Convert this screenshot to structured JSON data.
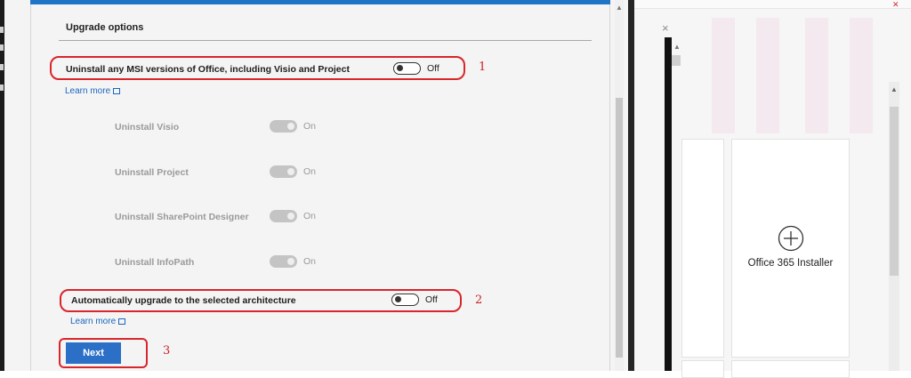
{
  "dialog": {
    "section_title": "Upgrade options",
    "uninstall_msi": {
      "label": "Uninstall any MSI versions of Office, including Visio and Project",
      "state": "Off",
      "learn_more": "Learn more"
    },
    "sub_options": [
      {
        "label": "Uninstall Visio",
        "state": "On"
      },
      {
        "label": "Uninstall Project",
        "state": "On"
      },
      {
        "label": "Uninstall SharePoint Designer",
        "state": "On"
      },
      {
        "label": "Uninstall InfoPath",
        "state": "On"
      }
    ],
    "auto_upgrade": {
      "label": "Automatically upgrade to the selected architecture",
      "state": "Off",
      "learn_more": "Learn more"
    },
    "next_label": "Next"
  },
  "callouts": {
    "one": "1",
    "two": "2",
    "three": "3"
  },
  "right_window": {
    "close_glyph": "×",
    "tile_label": "Office 365 Installer",
    "tile_icon": "plus-circle-icon"
  },
  "colors": {
    "accent": "#2b6fc6",
    "callout": "#d8262c",
    "link": "#1b66c0"
  }
}
